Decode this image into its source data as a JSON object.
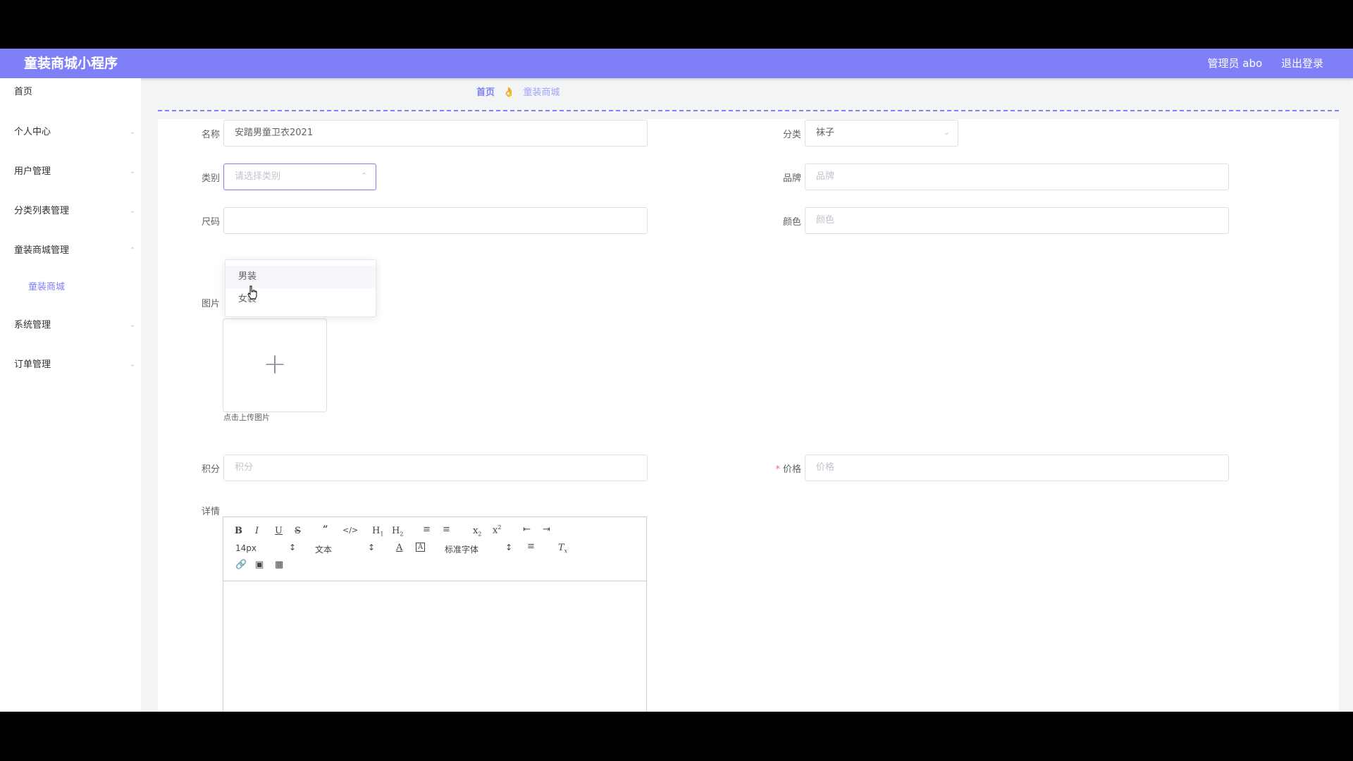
{
  "header": {
    "title": "童装商城小程序",
    "admin": "管理员 abo",
    "logout": "退出登录"
  },
  "sidebar": {
    "items": [
      {
        "label": "首页"
      },
      {
        "label": "个人中心"
      },
      {
        "label": "用户管理"
      },
      {
        "label": "分类列表管理"
      },
      {
        "label": "童装商城管理"
      },
      {
        "label": "童装商城"
      },
      {
        "label": "系统管理"
      },
      {
        "label": "订单管理"
      }
    ]
  },
  "breadcrumb": {
    "home": "首页",
    "separator": "👌",
    "current": "童装商城"
  },
  "form": {
    "name": {
      "label": "名称",
      "value": "安踏男童卫衣2021"
    },
    "category": {
      "label": "分类",
      "value": "袜子"
    },
    "type": {
      "label": "类别",
      "placeholder": "请选择类别",
      "options": [
        "男装",
        "女装"
      ]
    },
    "brand": {
      "label": "品牌",
      "placeholder": "品牌"
    },
    "size": {
      "label": "尺码"
    },
    "color": {
      "label": "颜色",
      "placeholder": "颜色"
    },
    "image": {
      "label": "图片",
      "hint": "点击上传图片"
    },
    "points": {
      "label": "积分",
      "placeholder": "积分"
    },
    "price": {
      "label": "价格",
      "placeholder": "价格",
      "required": "*"
    },
    "detail": {
      "label": "详情"
    }
  },
  "editor": {
    "font_size": "14px",
    "header_select": "文本",
    "font_family": "标准字体"
  },
  "colors": {
    "accent": "#7f7ff7",
    "background": "#f3f4f6"
  }
}
